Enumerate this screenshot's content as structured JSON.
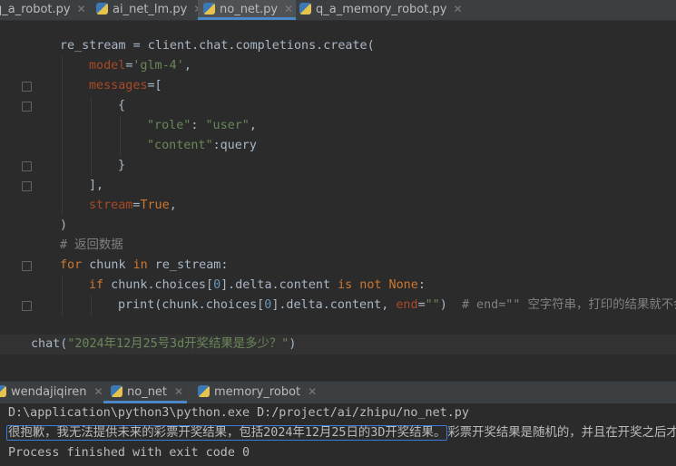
{
  "editor_tabs": [
    {
      "label": "q_a_robot.py",
      "active": false
    },
    {
      "label": "ai_net_lm.py",
      "active": false
    },
    {
      "label": "no_net.py",
      "active": true
    },
    {
      "label": "q_a_memory_robot.py",
      "active": false
    }
  ],
  "code": {
    "l1": {
      "a": "re_stream = client.chat.completions.create("
    },
    "l2": {
      "param": "model",
      "eq": "=",
      "str": "'glm-4'",
      "tail": ","
    },
    "l3": {
      "param": "messages",
      "eq": "=["
    },
    "l4": {
      "a": "{"
    },
    "l5": {
      "str": "\"role\"",
      "mid": ": ",
      "str2": "\"user\"",
      "tail": ","
    },
    "l6": {
      "str": "\"content\"",
      "mid": ":query"
    },
    "l7": {
      "a": "}"
    },
    "l8": {
      "a": "],"
    },
    "l9": {
      "param": "stream",
      "eq": "=",
      "kw": "True",
      "tail": ","
    },
    "l10": {
      "a": ")"
    },
    "l11": {
      "cm": "# 返回数据"
    },
    "l12": {
      "kw1": "for",
      "a": " chunk ",
      "kw2": "in",
      "b": " re_stream:"
    },
    "l13": {
      "kw1": "if",
      "a": " chunk.choices[",
      "num": "0",
      "b": "].delta.content ",
      "kw2": "is not None",
      "c": ":"
    },
    "l14": {
      "a": "print(chunk.choices[",
      "num": "0",
      "b": "].delta.content, ",
      "param": "end",
      "eq": "=",
      "str": "\"\"",
      "c": ")  ",
      "cm": "# end=\"\" 空字符串，打印的结果就不会"
    },
    "l15": {
      "a": "chat(",
      "str": "\"2024年12月25号3d开奖结果是多少？\"",
      "b": ")"
    }
  },
  "run_tabs": [
    {
      "label": "wendajiqiren",
      "active": false
    },
    {
      "label": "no_net",
      "active": true
    },
    {
      "label": "memory_robot",
      "active": false
    }
  ],
  "console": {
    "cmd": "D:\\application\\python3\\python.exe D:/project/ai/zhipu/no_net.py",
    "output_selected": "很抱歉，我无法提供未来的彩票开奖结果，包括2024年12月25日的3D开奖结果。",
    "output_rest": "彩票开奖结果是随机的，并且在开奖之后才能知",
    "exit": "Process finished with exit code 0"
  },
  "colors": {
    "background": "#2b2b2b",
    "keyword": "#cc7832",
    "string": "#6a8759",
    "param": "#aa4926",
    "accent": "#4a88c7"
  }
}
